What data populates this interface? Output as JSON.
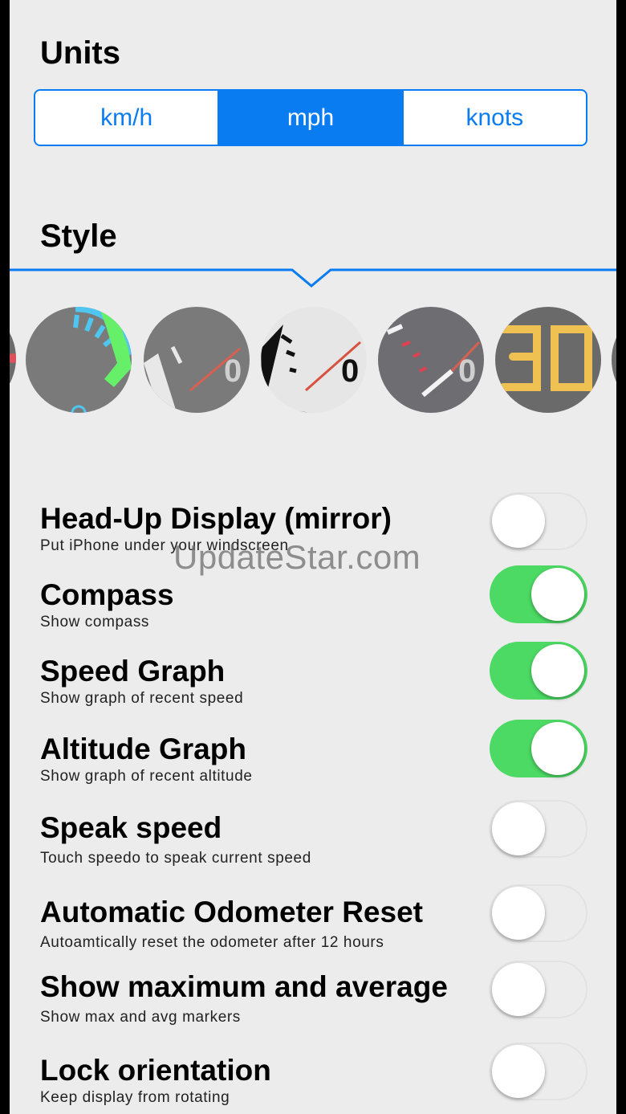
{
  "units": {
    "title": "Units",
    "options": [
      "km/h",
      "mph",
      "knots"
    ],
    "selected": "mph"
  },
  "style": {
    "title": "Style",
    "dial_digits": [
      "0",
      "0",
      "0",
      "0",
      "30"
    ],
    "colors": {
      "accent": "#0a7cf2",
      "toggle_on": "#4cd964"
    }
  },
  "watermark": "UpdateStar.com",
  "settings": [
    {
      "title": "Head-Up Display (mirror)",
      "subtitle": "Put iPhone under your windscreen",
      "enabled": false
    },
    {
      "title": "Compass",
      "subtitle": "Show compass",
      "enabled": true
    },
    {
      "title": "Speed Graph",
      "subtitle": "Show graph of recent speed",
      "enabled": true
    },
    {
      "title": "Altitude Graph",
      "subtitle": "Show graph of recent altitude",
      "enabled": true
    },
    {
      "title": "Speak speed",
      "subtitle": "Touch speedo to speak current speed",
      "enabled": false
    },
    {
      "title": "Automatic Odometer Reset",
      "subtitle": "Autoamtically reset the odometer after 12 hours",
      "enabled": false
    },
    {
      "title": "Show maximum and average",
      "subtitle": "Show max and avg markers",
      "enabled": false
    },
    {
      "title": "Lock orientation",
      "subtitle": "Keep display from rotating",
      "enabled": false
    }
  ]
}
